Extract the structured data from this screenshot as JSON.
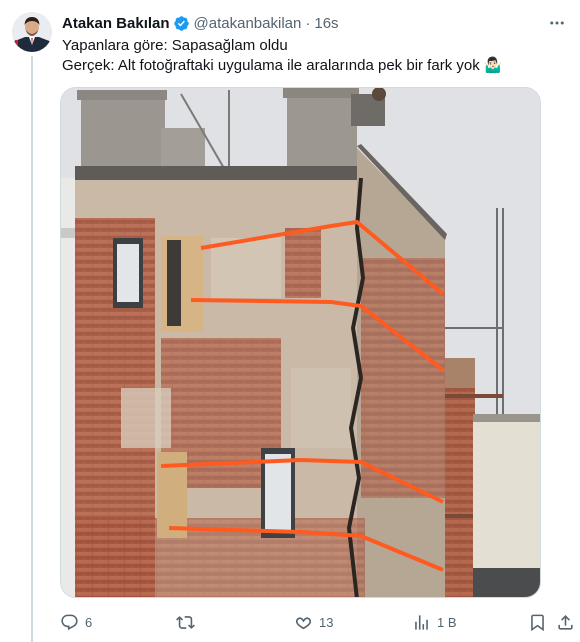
{
  "author": {
    "name": "Atakan Bakılan",
    "handle": "@atakanbakilan",
    "separator": "·",
    "time": "16s",
    "verified": true
  },
  "tweet": {
    "line1": "Yapanlara göre: Sapasağlam oldu",
    "line2": "Gerçek: Alt fotoğraftaki uygulama ile aralarında pek bir fark yok",
    "line2_emoji": "🤷🏻‍♂️"
  },
  "media": {
    "description_icon": "building-photo"
  },
  "actions": {
    "replies": "6",
    "retweets": "",
    "likes": "13",
    "views": "1 B"
  },
  "colors": {
    "accent": "#1d9bf0",
    "muted": "#536471",
    "strap": "#ff5a1f"
  }
}
